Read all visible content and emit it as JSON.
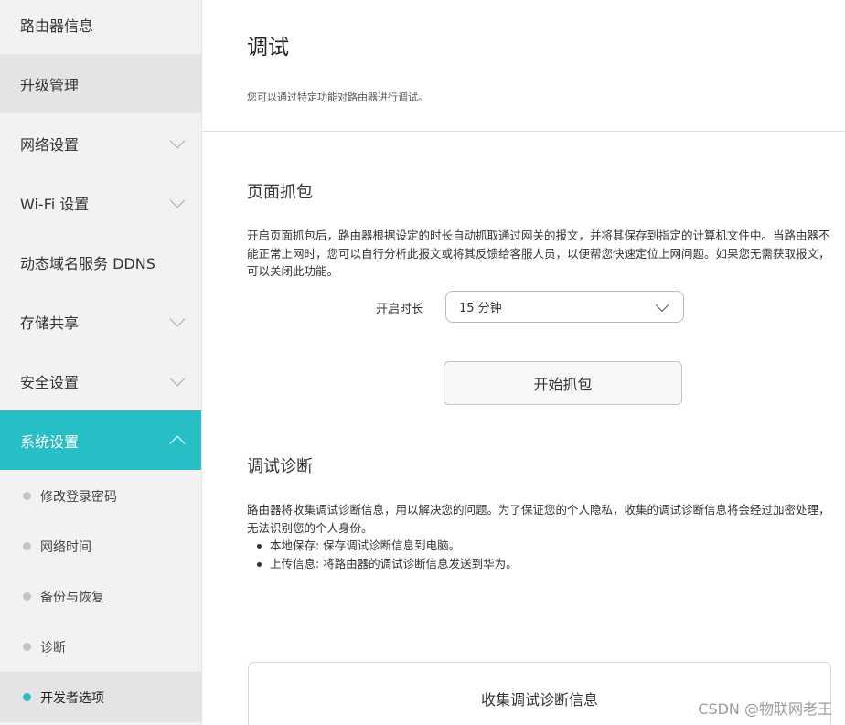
{
  "sidebar": {
    "items": [
      {
        "label": "路由器信息"
      },
      {
        "label": "升级管理"
      },
      {
        "label": "网络设置"
      },
      {
        "label": "Wi-Fi 设置"
      },
      {
        "label": "动态域名服务 DDNS"
      },
      {
        "label": "存储共享"
      },
      {
        "label": "安全设置"
      },
      {
        "label": "系统设置"
      }
    ],
    "sub_items": [
      {
        "label": "修改登录密码"
      },
      {
        "label": "网络时间"
      },
      {
        "label": "备份与恢复"
      },
      {
        "label": "诊断"
      },
      {
        "label": "开发者选项"
      }
    ]
  },
  "main": {
    "title": "调试",
    "description": "您可以通过特定功能对路由器进行调试。",
    "capture": {
      "title": "页面抓包",
      "description": "开启页面抓包后，路由器根据设定的时长自动抓取通过网关的报文，并将其保存到指定的计算机文件中。当路由器不能正常上网时，您可以自行分析此报文或将其反馈给客服人员，以便帮您快速定位上网问题。如果您无需获取报文，可以关闭此功能。",
      "duration_label": "开启时长",
      "duration_value": "15 分钟",
      "start_button": "开始抓包"
    },
    "diagnosis": {
      "title": "调试诊断",
      "description": "路由器将收集调试诊断信息，用以解决您的问题。为了保证您的个人隐私，收集的调试诊断信息将会经过加密处理，无法识别您的个人身份。",
      "bullets": [
        "本地保存: 保存调试诊断信息到电脑。",
        "上传信息: 将路由器的调试诊断信息发送到华为。"
      ],
      "collect_button": "收集调试诊断信息"
    }
  },
  "watermark": "CSDN @物联网老王",
  "colors": {
    "accent": "#26bfc6",
    "sidebar_bg": "#f2f2f2",
    "selected_bg": "#e4e4e4"
  }
}
